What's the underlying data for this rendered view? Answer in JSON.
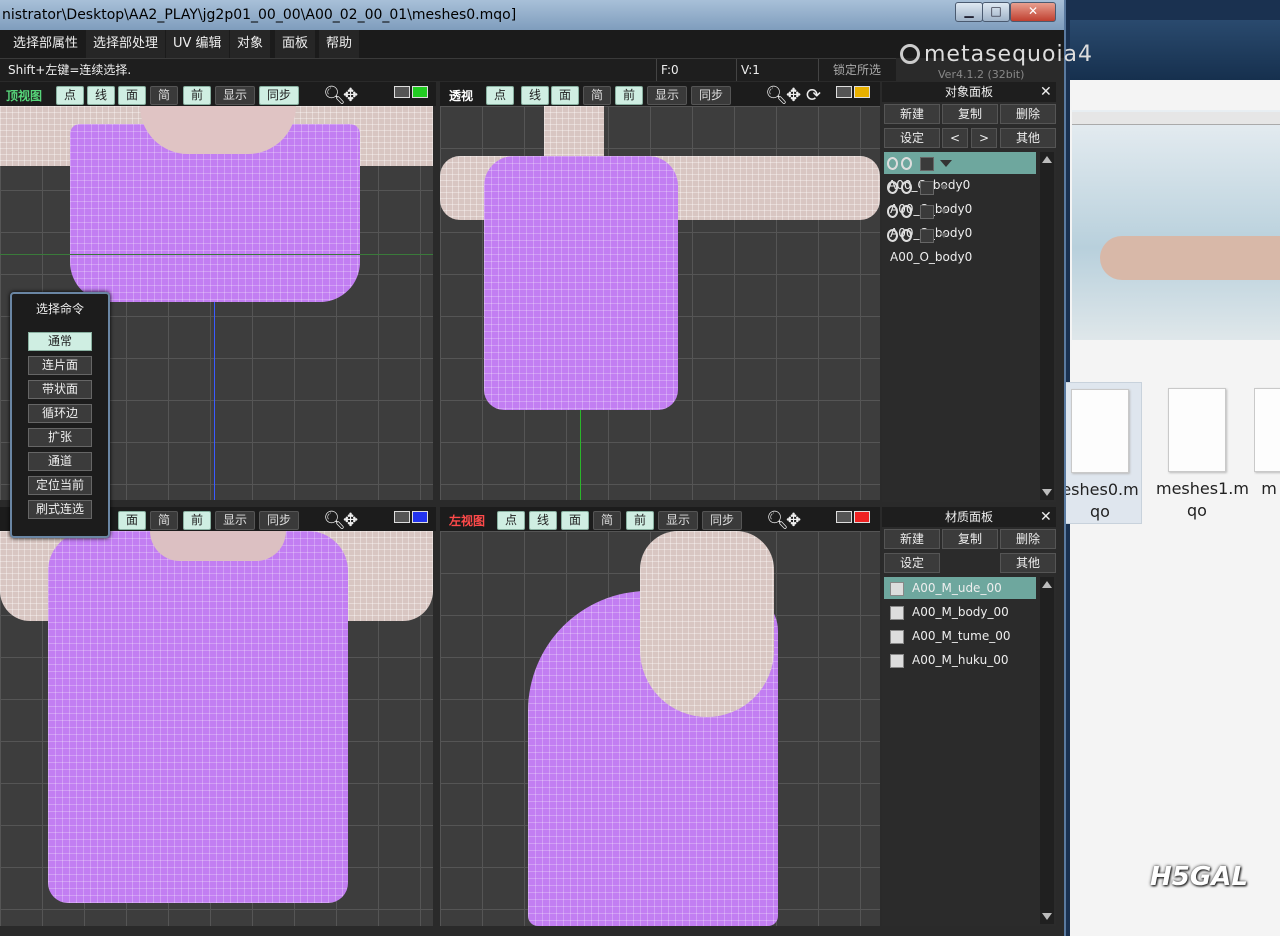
{
  "window": {
    "title": "nistrator\\Desktop\\AA2_PLAY\\jg2p01_00_00\\A00_02_00_01\\meshes0.mqo]",
    "controls": {
      "minimize": "▁",
      "maximize": "□",
      "close": "✕"
    }
  },
  "menu": [
    "选择部属性",
    "选择部处理",
    "UV 编辑",
    "对象",
    "面板",
    "帮助"
  ],
  "status": {
    "hint": "Shift+左键=连续选择.",
    "frame": "F:0",
    "vertex": "V:1",
    "lock": "锁定所选"
  },
  "logo": {
    "name": "metasequoia4",
    "version": "Ver4.1.2 (32bit)"
  },
  "viewport_buttons": {
    "point": "点",
    "line": "线",
    "face": "面",
    "simple": "简",
    "front": "前",
    "display": "显示",
    "sync": "同步"
  },
  "viewports": {
    "top": {
      "label": "顶视图",
      "label_color": "#57d57a"
    },
    "perspective": {
      "label": "透视",
      "label_color": "#ffffff"
    },
    "front": {
      "label": "",
      "label_color": "#5f7fff"
    },
    "left": {
      "label": "左视图",
      "label_color": "#ff4a4a"
    }
  },
  "icons": {
    "zoom": "zoom-icon",
    "pan": "move-icon",
    "rotate": "rotate-icon",
    "monitor": "monitor-icon",
    "close": "close-icon",
    "eye": "eye-icon"
  },
  "monitor_colors": {
    "top": "#22cc22",
    "perspective": "#e8b000",
    "front": "#2233ee",
    "left": "#ee2222"
  },
  "object_panel": {
    "title": "对象面板",
    "buttons": {
      "new": "新建",
      "copy": "复制",
      "delete": "删除",
      "settings": "设定",
      "prev": "<",
      "next": ">",
      "other": "其他"
    },
    "items": [
      {
        "name": "A00_O_body0"
      },
      {
        "name": "A00_O_body0"
      },
      {
        "name": "A00_O_body0"
      },
      {
        "name": "A00_O_body0"
      }
    ]
  },
  "material_panel": {
    "title": "材质面板",
    "buttons": {
      "new": "新建",
      "copy": "复制",
      "delete": "删除",
      "settings": "设定",
      "other": "其他"
    },
    "items": [
      {
        "name": "A00_M_ude_00"
      },
      {
        "name": "A00_M_body_00"
      },
      {
        "name": "A00_M_tume_00"
      },
      {
        "name": "A00_M_huku_00"
      }
    ]
  },
  "select_commands": {
    "title": "选择命令",
    "items": [
      "通常",
      "连片面",
      "带状面",
      "循环边",
      "扩张",
      "通道",
      "定位当前",
      "刷式连选"
    ]
  },
  "desktop": {
    "files": [
      {
        "name_line1": "eshes0.m",
        "name_line2": "qo"
      },
      {
        "name_line1": "meshes1.m",
        "name_line2": "qo"
      },
      {
        "name_line1": "m",
        "name_line2": ""
      }
    ],
    "watermark": "H5GAL"
  },
  "colors": {
    "accent_selected": "#6ea79e",
    "button_on": "#cfeee2",
    "mesh_purple": "#c27ef2"
  }
}
